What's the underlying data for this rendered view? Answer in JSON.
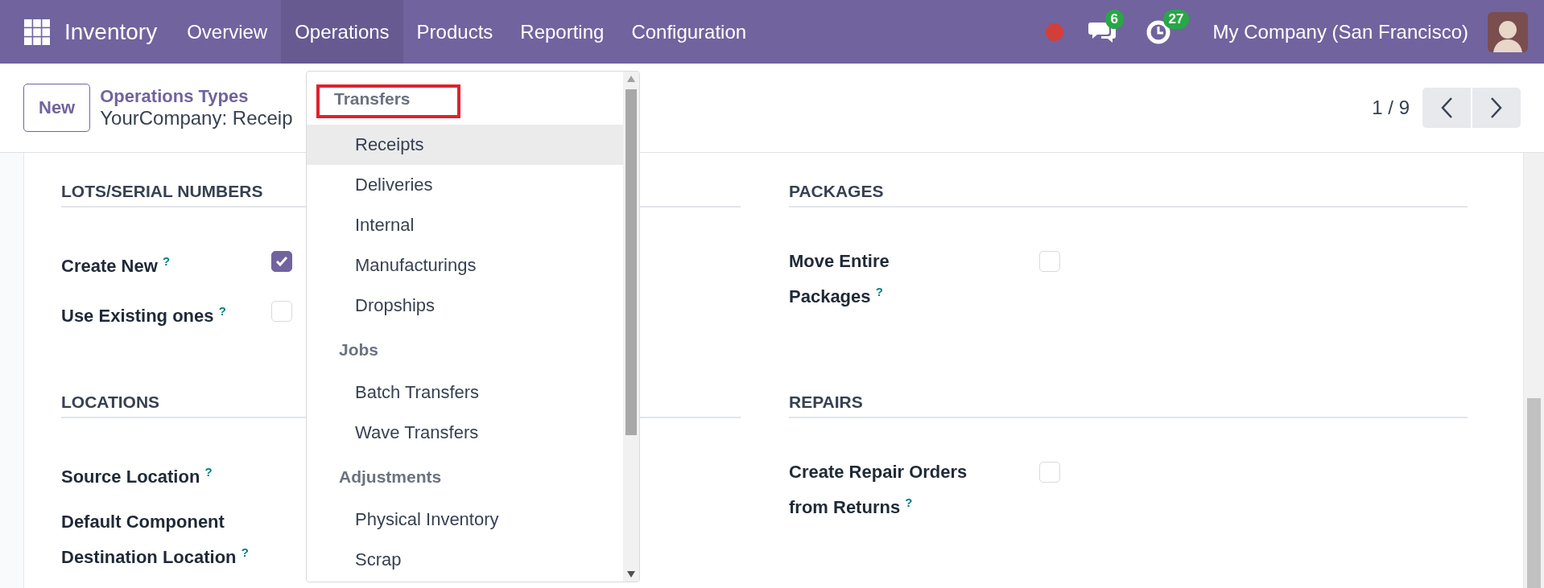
{
  "navbar": {
    "app_name": "Inventory",
    "menus": [
      {
        "label": "Overview",
        "selected": false
      },
      {
        "label": "Operations",
        "selected": true
      },
      {
        "label": "Products",
        "selected": false
      },
      {
        "label": "Reporting",
        "selected": false
      },
      {
        "label": "Configuration",
        "selected": false
      }
    ],
    "chat_count": "6",
    "activity_count": "27",
    "company": "My Company (San Francisco)"
  },
  "control_panel": {
    "new_button": "New",
    "breadcrumb_parent": "Operations Types",
    "record_title": "YourCompany: Receip",
    "pager": "1 / 9"
  },
  "form": {
    "columns": [
      {
        "sections": [
          {
            "title": "LOTS/SERIAL NUMBERS",
            "fields": [
              {
                "label": "Create New",
                "help": "?",
                "kind": "checkbox",
                "checked": true
              },
              {
                "label": "Use Existing ones",
                "help": "?",
                "kind": "checkbox",
                "checked": false
              }
            ]
          },
          {
            "title": "LOCATIONS",
            "fields": [
              {
                "label": "Source Location",
                "help": "?",
                "kind": "field"
              },
              {
                "label": "Default Component Destination Location",
                "help": "?",
                "kind": "field"
              }
            ]
          }
        ]
      },
      {
        "sections": [
          {
            "title": "PACKAGES",
            "fields": [
              {
                "label": "Move Entire Packages",
                "help": "?",
                "kind": "checkbox",
                "checked": false
              }
            ]
          },
          {
            "title": "REPAIRS",
            "fields": [
              {
                "label": "Create Repair Orders from Returns",
                "help": "?",
                "kind": "checkbox",
                "checked": false
              }
            ]
          }
        ]
      }
    ]
  },
  "dropdown": {
    "groups": [
      {
        "title": "Transfers",
        "highlighted": true,
        "items": [
          {
            "label": "Receipts",
            "selected": true
          },
          {
            "label": "Deliveries",
            "selected": false
          },
          {
            "label": "Internal",
            "selected": false
          },
          {
            "label": "Manufacturings",
            "selected": false
          },
          {
            "label": "Dropships",
            "selected": false
          }
        ]
      },
      {
        "title": "Jobs",
        "highlighted": false,
        "items": [
          {
            "label": "Batch Transfers",
            "selected": false
          },
          {
            "label": "Wave Transfers",
            "selected": false
          }
        ]
      },
      {
        "title": "Adjustments",
        "highlighted": false,
        "items": [
          {
            "label": "Physical Inventory",
            "selected": false
          },
          {
            "label": "Scrap",
            "selected": false
          }
        ]
      }
    ]
  }
}
